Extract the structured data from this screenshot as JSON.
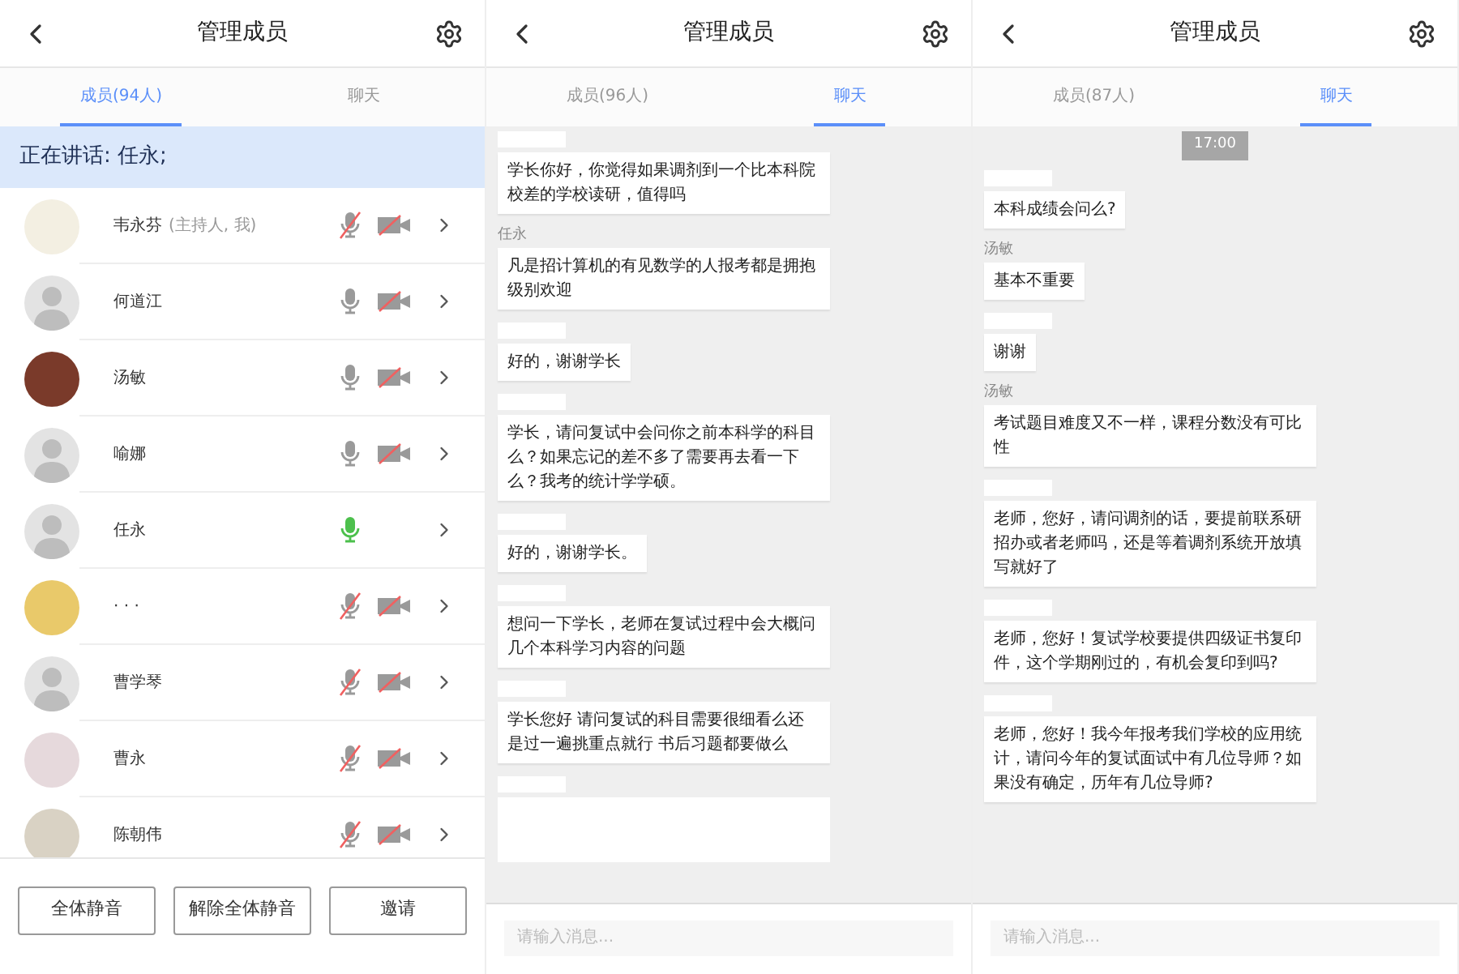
{
  "panels": [
    {
      "kind": "members",
      "title": "管理成员",
      "tabs": [
        {
          "label": "成员(94人)",
          "selected": true
        },
        {
          "label": "聊天",
          "selected": false
        }
      ],
      "speaking": "正在讲话: 任永;",
      "members": [
        {
          "name": "韦永芬",
          "note": "(主持人, 我)",
          "has_photo": true,
          "color": "#f3efe2",
          "mic_muted": true,
          "speaking": false,
          "camera_visible": true
        },
        {
          "name": "何道江",
          "has_photo": false,
          "mic_muted": false,
          "speaking": false,
          "camera_visible": true
        },
        {
          "name": "汤敏",
          "has_photo": true,
          "color": "#7a3a2a",
          "mic_muted": false,
          "speaking": false,
          "camera_visible": true
        },
        {
          "name": "喻娜",
          "has_photo": false,
          "mic_muted": false,
          "speaking": false,
          "camera_visible": true
        },
        {
          "name": "任永",
          "has_photo": false,
          "mic_muted": false,
          "speaking": true,
          "camera_visible": false
        },
        {
          "name": "· · ·",
          "has_photo": true,
          "color": "#e9c96a",
          "mic_muted": true,
          "speaking": false,
          "camera_visible": true
        },
        {
          "name": "曹学琴",
          "has_photo": false,
          "mic_muted": true,
          "speaking": false,
          "camera_visible": true
        },
        {
          "name": "曹永",
          "has_photo": true,
          "color": "#e6d9dc",
          "mic_muted": true,
          "speaking": false,
          "camera_visible": true
        },
        {
          "name": "陈朝伟",
          "has_photo": true,
          "color": "#d9d2c4",
          "mic_muted": true,
          "speaking": false,
          "camera_visible": true
        }
      ],
      "buttons": [
        "全体静音",
        "解除全体静音",
        "邀请"
      ]
    },
    {
      "kind": "chat",
      "title": "管理成员",
      "tabs": [
        {
          "label": "成员(96人)",
          "selected": false
        },
        {
          "label": "聊天",
          "selected": true
        }
      ],
      "messages": [
        {
          "kind": "message",
          "sender_hidden": true,
          "text": "学长你好，你觉得如果调剂到一个比本科院校差的学校读研，值得吗"
        },
        {
          "kind": "message",
          "sender_hidden": false,
          "sender": "任永",
          "text": "凡是招计算机的有见数学的人报考都是拥抱级别欢迎"
        },
        {
          "kind": "message",
          "sender_hidden": true,
          "text": "好的，谢谢学长"
        },
        {
          "kind": "message",
          "sender_hidden": true,
          "text": "学长，请问复试中会问你之前本科学的科目么？如果忘记的差不多了需要再去看一下么？我考的统计学学硕。"
        },
        {
          "kind": "message",
          "sender_hidden": true,
          "text": "好的，谢谢学长。"
        },
        {
          "kind": "message",
          "sender_hidden": true,
          "text": "想问一下学长，老师在复试过程中会大概问几个本科学习内容的问题"
        },
        {
          "kind": "message",
          "sender_hidden": true,
          "text": "学长您好 请问复试的科目需要很细看么还是过一遍挑重点就行 书后习题都要做么"
        },
        {
          "kind": "cut",
          "sender_hidden": true
        }
      ],
      "input": {
        "placeholder": "请输入消息..."
      }
    },
    {
      "kind": "chat",
      "title": "管理成员",
      "tabs": [
        {
          "label": "成员(87人)",
          "selected": false
        },
        {
          "label": "聊天",
          "selected": true
        }
      ],
      "messages": [
        {
          "kind": "time",
          "text": "17:00"
        },
        {
          "kind": "message",
          "sender_hidden": true,
          "text": "本科成绩会问么?"
        },
        {
          "kind": "message",
          "sender_hidden": false,
          "sender": "汤敏",
          "text": "基本不重要"
        },
        {
          "kind": "message",
          "sender_hidden": true,
          "text": "谢谢"
        },
        {
          "kind": "message",
          "sender_hidden": false,
          "sender": "汤敏",
          "text": "考试题目难度又不一样，课程分数没有可比性"
        },
        {
          "kind": "message",
          "sender_hidden": true,
          "text": "老师，您好，请问调剂的话，要提前联系研招办或者老师吗，还是等着调剂系统开放填写就好了"
        },
        {
          "kind": "message",
          "sender_hidden": true,
          "text": "老师，您好！复试学校要提供四级证书复印件，这个学期刚过的，有机会复印到吗?"
        },
        {
          "kind": "message",
          "sender_hidden": true,
          "text": "老师，您好！我今年报考我们学校的应用统计，请问今年的复试面试中有几位导师？如果没有确定，历年有几位导师?"
        }
      ],
      "input": {
        "placeholder": "请输入消息..."
      }
    }
  ]
}
